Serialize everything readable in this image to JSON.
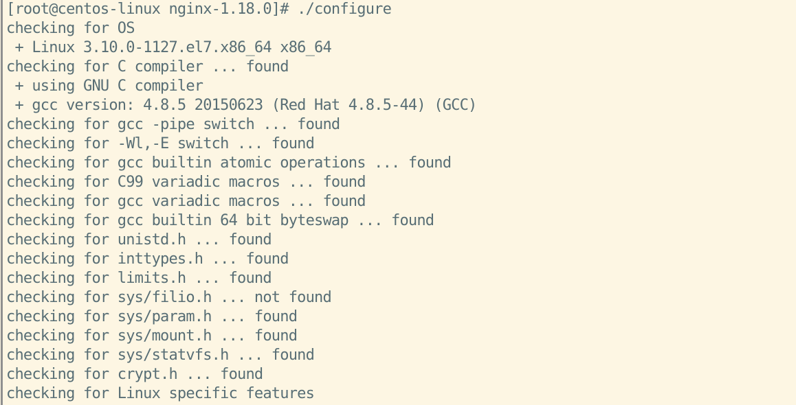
{
  "terminal": {
    "colors": {
      "background": "#fdf6e3",
      "text": "#586e75",
      "left_rule": "#8f8f8f"
    },
    "lines": [
      "[root@centos-linux nginx-1.18.0]# ./configure",
      "checking for OS",
      " + Linux 3.10.0-1127.el7.x86_64 x86_64",
      "checking for C compiler ... found",
      " + using GNU C compiler",
      " + gcc version: 4.8.5 20150623 (Red Hat 4.8.5-44) (GCC)",
      "checking for gcc -pipe switch ... found",
      "checking for -Wl,-E switch ... found",
      "checking for gcc builtin atomic operations ... found",
      "checking for C99 variadic macros ... found",
      "checking for gcc variadic macros ... found",
      "checking for gcc builtin 64 bit byteswap ... found",
      "checking for unistd.h ... found",
      "checking for inttypes.h ... found",
      "checking for limits.h ... found",
      "checking for sys/filio.h ... not found",
      "checking for sys/param.h ... found",
      "checking for sys/mount.h ... found",
      "checking for sys/statvfs.h ... found",
      "checking for crypt.h ... found",
      "checking for Linux specific features"
    ]
  }
}
